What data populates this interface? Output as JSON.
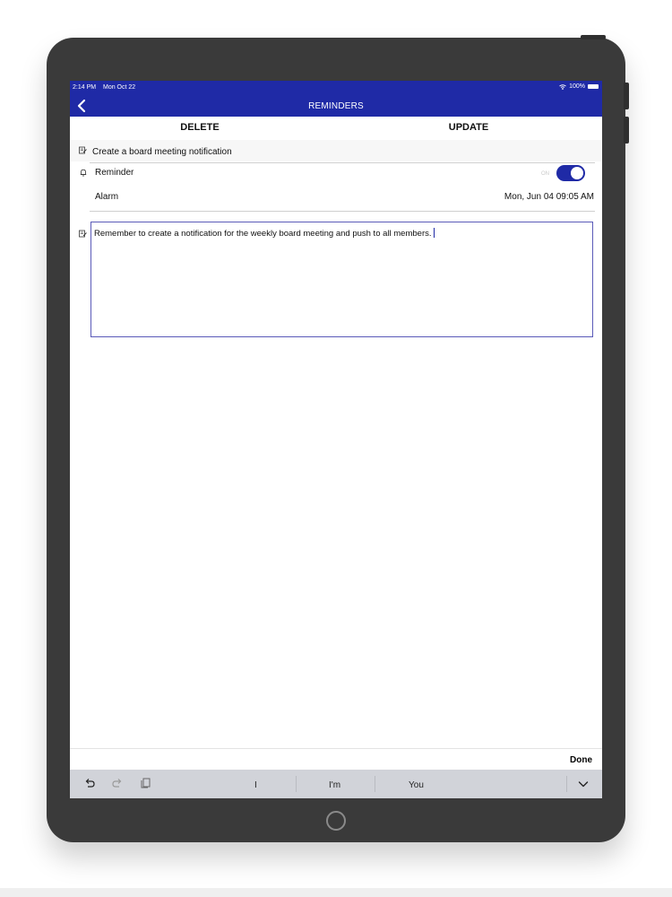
{
  "status_bar": {
    "time": "2:14 PM",
    "date": "Mon Oct 22",
    "battery": "100%"
  },
  "nav": {
    "title": "REMINDERS",
    "back_icon": "chevron-left-icon"
  },
  "actions": {
    "delete_label": "DELETE",
    "update_label": "UPDATE"
  },
  "reminder": {
    "title": "Create a board meeting notification",
    "reminder_label": "Reminder",
    "toggle_state": "ON",
    "toggle_on": true,
    "alarm_label": "Alarm",
    "alarm_value": "Mon, Jun 04 09:05 AM",
    "notes": "Remember to create a notification for the weekly board meeting and push to all members."
  },
  "keyboard": {
    "done_label": "Done",
    "suggestions": [
      "I",
      "I'm",
      "You"
    ],
    "icons": [
      "undo-icon",
      "redo-icon",
      "paste-icon",
      "chevron-down-icon"
    ]
  },
  "colors": {
    "accent": "#1f2aa6",
    "keyboard_bg": "#d1d3d9"
  }
}
